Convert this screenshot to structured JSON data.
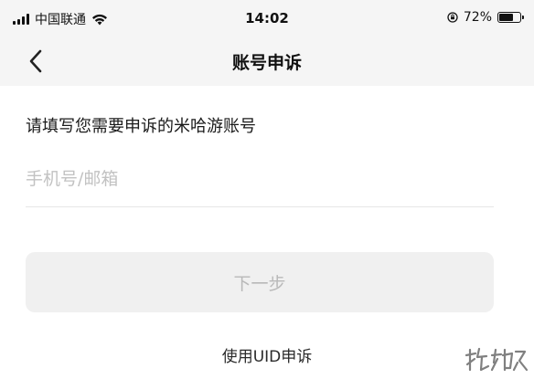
{
  "status_bar": {
    "carrier": "中国联通",
    "time": "14:02",
    "battery_percent_label": "72%",
    "battery_level": 0.72,
    "icons": [
      "signal-icon",
      "wifi-icon",
      "rotation-lock-icon",
      "battery-icon"
    ]
  },
  "nav": {
    "back_icon": "chevron-left-icon",
    "title": "账号申诉"
  },
  "form": {
    "prompt": "请填写您需要申诉的米哈游账号",
    "account_input": {
      "value": "",
      "placeholder": "手机号/邮箱"
    },
    "next_button_label": "下一步",
    "next_button_enabled": false,
    "uid_link_label": "使用UID申诉"
  },
  "colors": {
    "header_bg": "#f5f5f5",
    "placeholder": "#c2c2c2",
    "disabled_button_bg": "#f0f0f0",
    "disabled_button_text": "#b9b9b9"
  }
}
